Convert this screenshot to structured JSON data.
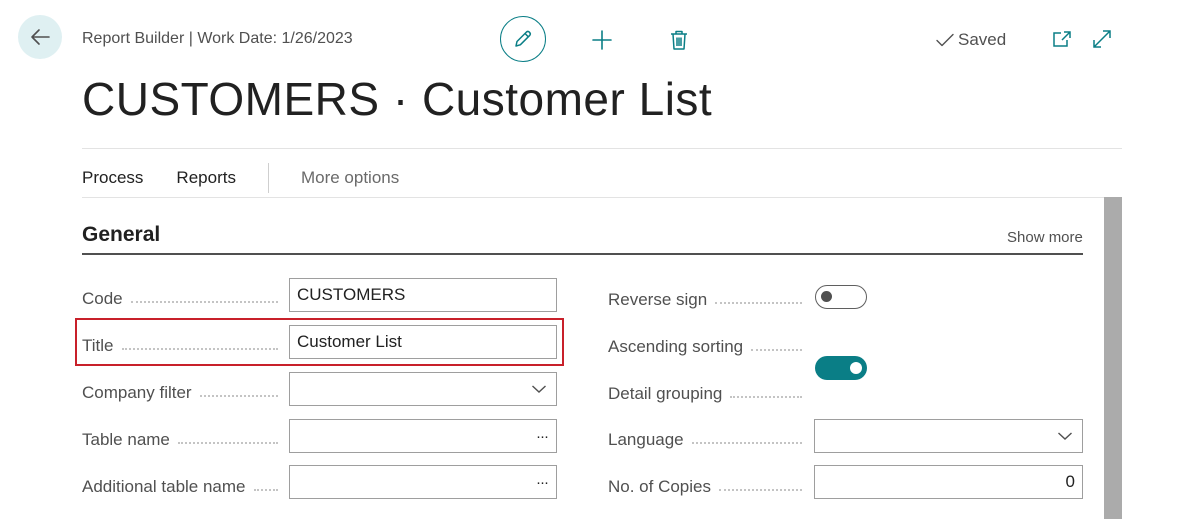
{
  "header": {
    "breadcrumb": "Report Builder | Work Date: 1/26/2023",
    "saved_label": "Saved",
    "page_title": "CUSTOMERS · Customer List",
    "icons": [
      "back-arrow-icon",
      "pencil-icon",
      "plus-icon",
      "trash-icon",
      "checkmark-icon",
      "open-in-new-window-icon",
      "expand-icon"
    ]
  },
  "actions": {
    "process": "Process",
    "reports": "Reports",
    "more_options": "More options"
  },
  "general": {
    "title": "General",
    "show_more": "Show more",
    "left_fields": {
      "code": {
        "label": "Code",
        "value": "CUSTOMERS"
      },
      "title": {
        "label": "Title",
        "value": "Customer List"
      },
      "company_filter": {
        "label": "Company filter",
        "value": ""
      },
      "table_name": {
        "label": "Table name",
        "value": ""
      },
      "additional_table_name": {
        "label": "Additional table name",
        "value": ""
      }
    },
    "right_fields": {
      "reverse_sign": {
        "label": "Reverse sign",
        "checked": false
      },
      "ascending_sorting": {
        "label": "Ascending sorting",
        "checked": true
      },
      "detail_grouping": {
        "label": "Detail grouping",
        "checked": false
      },
      "language": {
        "label": "Language",
        "value": ""
      },
      "no_of_copies": {
        "label": "No. of Copies",
        "value": "0"
      }
    },
    "lookup_glyph": "···"
  },
  "colors": {
    "accent": "#0a7e86",
    "highlight_border": "#c8202a",
    "back_button_bg": "#dff0f2"
  }
}
